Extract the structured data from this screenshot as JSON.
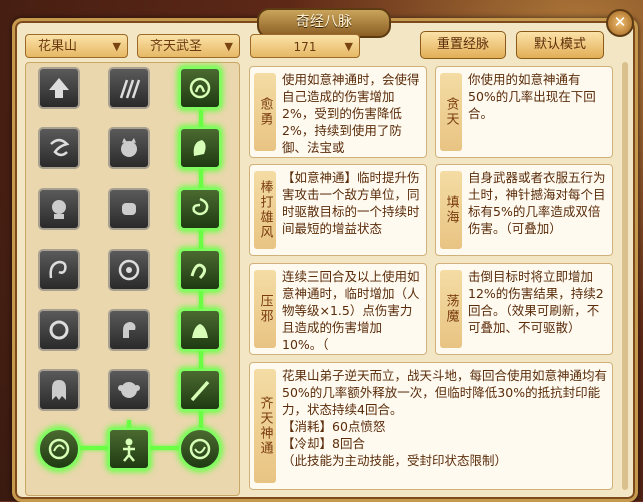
{
  "window": {
    "title": "奇经八脉",
    "close_label": "✕"
  },
  "filters": {
    "school": "花果山",
    "path": "齐天武圣",
    "points": "171"
  },
  "buttons": {
    "reset": "重置经脉",
    "default": "默认模式"
  },
  "skills": [
    {
      "name": "愈勇",
      "desc": "使用如意神通时，会使得自己造成的伤害增加2%，受到的伤害降低2%，持续到使用了防御、法宝或"
    },
    {
      "name": "贪天",
      "desc": "你使用的如意神通有50%的几率出现在下回合。"
    },
    {
      "name": "棒打雄风",
      "desc": "【如意神通】临时提升伤害攻击一个敌方单位，同时驱散目标的一个持续时间最短的增益状态"
    },
    {
      "name": "填海",
      "desc": "自身武器或者衣服五行为土时，神针撼海对每个目标有5%的几率造成双倍伤害。（可叠加）"
    },
    {
      "name": "压邪",
      "desc": "连续三回合及以上使用如意神通时，临时增加（人物等级×1.5）点伤害力且造成的伤害增加10%。（"
    },
    {
      "name": "荡魔",
      "desc": "击倒目标时将立即增加12%的伤害结果，持续2回合。（效果可刷新，不可叠加、不可驱散）"
    },
    {
      "name": "齐天神通",
      "desc": "花果山弟子逆天而立，战天斗地，每回合使用如意神通均有50%的几率额外释放一次，但临时降低30%的抵抗封印能力，状态持续4回合。\n【消耗】60点愤怒\n【冷却】8回合\n（此技能为主动技能，受封印状态限制）"
    }
  ],
  "icons": [
    "arrow-up-icon",
    "claw-icon",
    "twin-flame-icon",
    "wind-swirl-icon",
    "cat-face-icon",
    "horn-icon",
    "head-gear-icon",
    "fist-icon",
    "vortex-icon",
    "horn-curl-icon",
    "spiral-icon",
    "serpent-icon",
    "ring-icon",
    "muscle-arm-icon",
    "beast-icon",
    "ghost-icon",
    "monkey-icon",
    "staff-icon",
    "orb-left-icon",
    "warrior-icon",
    "orb-right-icon"
  ]
}
